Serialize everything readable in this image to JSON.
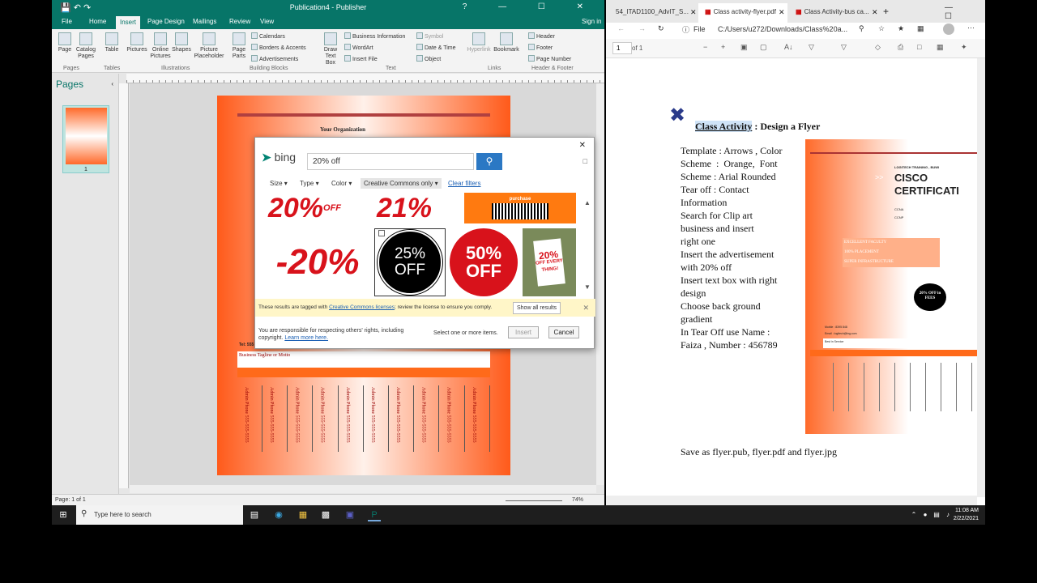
{
  "publisher": {
    "title": "Publication4 - Publisher",
    "tabs": [
      "File",
      "Home",
      "Insert",
      "Page Design",
      "Mailings",
      "Review",
      "View"
    ],
    "active_tab": "Insert",
    "sign_in": "Sign in",
    "ribbon": {
      "page": "Page",
      "catalog_pages": "Catalog Pages",
      "table": "Table",
      "pictures": "Pictures",
      "online_pictures": "Online Pictures",
      "shapes": "Shapes",
      "picture_placeholder": "Picture Placeholder",
      "page_parts": "Page Parts",
      "calendars": "Calendars",
      "borders_accents": "Borders & Accents",
      "advertisements": "Advertisements",
      "draw_text_box": "Draw Text Box",
      "business_information": "Business Information",
      "wordart": "WordArt",
      "insert_file": "Insert File",
      "symbol": "Symbol",
      "date_time": "Date & Time",
      "object": "Object",
      "hyperlink": "Hyperlink",
      "bookmark": "Bookmark",
      "header": "Header",
      "footer": "Footer",
      "page_number": "Page Number",
      "groups": [
        "Pages",
        "Tables",
        "Illustrations",
        "Building Blocks",
        "Text",
        "Links",
        "Header & Footer"
      ]
    },
    "pages_pane_title": "Pages",
    "thumb_number": "1",
    "status_page": "Page: 1 of 1",
    "zoom": "74%"
  },
  "flyer": {
    "org": "Your Organization",
    "tel": "Tel: 555",
    "tagline": "Business Tagline or Motto",
    "strip_text": "Admin Phone 555-555-5555",
    "strip_count": 10
  },
  "bing": {
    "logo": "bing",
    "query": "20% off",
    "filters": {
      "size": "Size",
      "type": "Type",
      "color": "Color",
      "license": "Creative Commons only",
      "clear": "Clear filters"
    },
    "results": {
      "r1": "20%",
      "r1_off": "OFF",
      "r2": "21%",
      "r3": "purchase",
      "r4": "-20%",
      "r5": "25%",
      "r5_off": "OFF",
      "r6": "50%",
      "r6_off": "OFF",
      "r7": "20%",
      "r7_sub": "OFF EVERY THING!"
    },
    "notice_pre": "These results are tagged with",
    "notice_link": "Creative Commons licenses",
    "notice_post": "; review the license to ensure you comply.",
    "show_all": "Show all results",
    "responsible": "You are responsible for respecting others' rights, including copyright.",
    "learn_more": "Learn more here.",
    "select_hint": "Select one or more items.",
    "insert": "Insert",
    "cancel": "Cancel"
  },
  "pdf": {
    "tabs": [
      "54_ITAD1100_AdvIT_S...",
      "Class activity-flyer.pdf",
      "Class Activity-bus ca..."
    ],
    "address_label": "File",
    "address": "C:/Users/u272/Downloads/Class%20a...",
    "page_input": "1",
    "page_of": "of 1",
    "heading_highlight": "Class Activity",
    "heading_rest": " : Design a Flyer",
    "body_lines": [
      "Template : Arrows , Color",
      "Scheme  :  Orange,  Font",
      "Scheme : Arial Rounded",
      "Tear off : Contact",
      "Information",
      "Search for Clip art",
      "business and insert",
      "right one",
      "Insert the advertisement",
      "with 20% off",
      "Insert text box with right",
      "design",
      "Choose back ground",
      "gradient",
      "In Tear Off use Name :",
      "Faiza , Number : 456789"
    ],
    "save_line": "Save as flyer.pub, flyer.pdf and flyer.jpg",
    "mini": {
      "training": "LOGITECH TRAINING , BUWI",
      "arrows": ">>",
      "title1": "CISCO",
      "title2": "CERTIFICATI",
      "sub1": "CCNA",
      "sub2": "CCNP",
      "feat1": "EXCELLENT FACULTY",
      "feat2": "100% PLACEMENT",
      "feat3": "SUPER INFRASTRUCTURE",
      "badge": "20% OFF in FEES",
      "mobile": "Mobile : 8395 848",
      "email": "Email : logitech@ing.com",
      "service": "Best in Service"
    }
  },
  "taskbar": {
    "search_placeholder": "Type here to search",
    "time": "11:08 AM",
    "date": "2/22/2021"
  },
  "colors": {
    "publisher_accent": "#077568",
    "bing_button": "#2b78c4",
    "flyer_orange": "#ff5a1a",
    "highlight": "#cfe3f7"
  }
}
